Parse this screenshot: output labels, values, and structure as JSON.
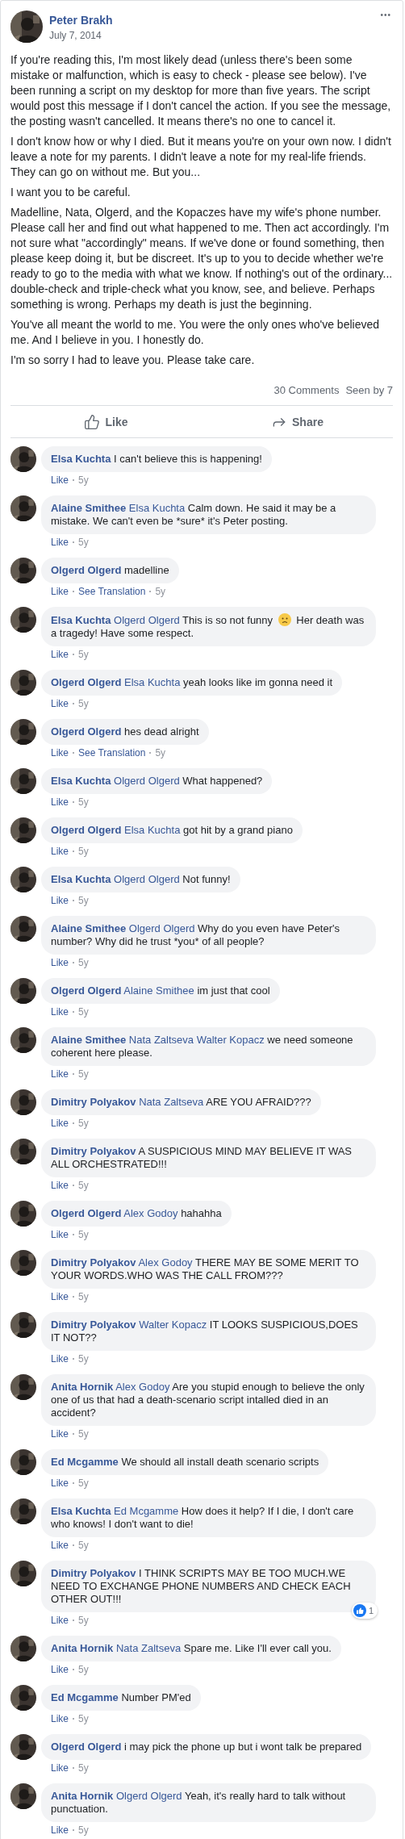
{
  "post": {
    "author": "Peter Brakh",
    "date": "July 7, 2014",
    "menu": "•••",
    "paragraphs": [
      "If you're reading this, I'm most likely dead (unless there's been some mistake or malfunction, which is easy to check - please see below). I've been running a script on my desktop for more than five years. The script would post this message if I don't cancel the action. If you see the message, the posting wasn't cancelled. It means there's no one to cancel it.",
      "I don't know how or why I died. But it means you're on your own now. I didn't leave a note for my parents. I didn't leave a note for my real-life friends. They can go on without me. But you...",
      "I want you to be careful.",
      "Madelline, Nata, Olgerd, and the Kopaczes have my wife's phone number. Please call her and find out what happened to me. Then act accordingly. I'm not sure what \"accordingly\" means. If we've done or found something, then please keep doing it, but be discreet. It's up to you to decide whether we're ready to go to the media with what we know. If nothing's out of the ordinary... double-check and triple-check what you know, see, and believe. Perhaps something is wrong. Perhaps my death is just the beginning.",
      "You've all meant the world to me. You were the only ones who've believed me. And I believe in you. I honestly do.",
      "I'm so sorry I had to leave you. Please take care."
    ],
    "comments_count": "30 Comments",
    "seen_by": "Seen by 7",
    "actions": [
      {
        "kind": "like",
        "label": "Like"
      },
      {
        "kind": "share",
        "label": "Share"
      }
    ]
  },
  "comments": [
    {
      "author": "Elsa Kuchta",
      "parts": [
        {
          "kind": "text",
          "text": "I can't believe this is happening!"
        }
      ],
      "like": "Like",
      "time": "5y"
    },
    {
      "author": "Alaine Smithee",
      "mentions": [
        "Elsa Kuchta"
      ],
      "parts": [
        {
          "kind": "text",
          "text": "Calm down. He said it may be a mistake. We can't even be *sure* it's Peter posting."
        }
      ],
      "like": "Like",
      "time": "5y"
    },
    {
      "author": "Olgerd Olgerd",
      "parts": [
        {
          "kind": "text",
          "text": "madelline"
        }
      ],
      "like": "Like",
      "translation": "See Translation",
      "time": "5y"
    },
    {
      "author": "Elsa Kuchta",
      "mentions": [
        "Olgerd Olgerd"
      ],
      "parts": [
        {
          "kind": "text",
          "text": "This is so not funny"
        },
        {
          "kind": "emoji"
        },
        {
          "kind": "text",
          "text": "Her death was a tragedy! Have some respect."
        }
      ],
      "like": "Like",
      "time": "5y"
    },
    {
      "author": "Olgerd Olgerd",
      "mentions": [
        "Elsa Kuchta"
      ],
      "parts": [
        {
          "kind": "text",
          "text": "yeah looks like im gonna need it"
        }
      ],
      "like": "Like",
      "time": "5y"
    },
    {
      "author": "Olgerd Olgerd",
      "parts": [
        {
          "kind": "text",
          "text": "hes dead alright"
        }
      ],
      "like": "Like",
      "translation": "See Translation",
      "time": "5y"
    },
    {
      "author": "Elsa Kuchta",
      "mentions": [
        "Olgerd Olgerd"
      ],
      "parts": [
        {
          "kind": "text",
          "text": "What happened?"
        }
      ],
      "like": "Like",
      "time": "5y"
    },
    {
      "author": "Olgerd Olgerd",
      "mentions": [
        "Elsa Kuchta"
      ],
      "parts": [
        {
          "kind": "text",
          "text": "got hit by a grand piano"
        }
      ],
      "like": "Like",
      "time": "5y"
    },
    {
      "author": "Elsa Kuchta",
      "mentions": [
        "Olgerd Olgerd"
      ],
      "parts": [
        {
          "kind": "text",
          "text": "Not funny!"
        }
      ],
      "like": "Like",
      "time": "5y"
    },
    {
      "author": "Alaine Smithee",
      "mentions": [
        "Olgerd Olgerd"
      ],
      "parts": [
        {
          "kind": "text",
          "text": "Why do you even have Peter's number? Why did he trust *you* of all people?"
        }
      ],
      "like": "Like",
      "time": "5y"
    },
    {
      "author": "Olgerd Olgerd",
      "mentions": [
        "Alaine Smithee"
      ],
      "parts": [
        {
          "kind": "text",
          "text": "im just that cool"
        }
      ],
      "like": "Like",
      "time": "5y"
    },
    {
      "author": "Alaine Smithee",
      "mentions": [
        "Nata Zaltseva",
        "Walter Kopacz"
      ],
      "parts": [
        {
          "kind": "text",
          "text": "we need someone coherent here please."
        }
      ],
      "like": "Like",
      "time": "5y"
    },
    {
      "author": "Dimitry Polyakov",
      "mentions": [
        "Nata Zaltseva"
      ],
      "parts": [
        {
          "kind": "text",
          "text": "ARE YOU AFRAID???"
        }
      ],
      "like": "Like",
      "time": "5y"
    },
    {
      "author": "Dimitry Polyakov",
      "parts": [
        {
          "kind": "text",
          "text": "A SUSPICIOUS MIND MAY BELIEVE IT WAS ALL ORCHESTRATED!!!"
        }
      ],
      "like": "Like",
      "time": "5y"
    },
    {
      "author": "Olgerd Olgerd",
      "mentions": [
        "Alex Godoy"
      ],
      "parts": [
        {
          "kind": "text",
          "text": "hahahha"
        }
      ],
      "like": "Like",
      "time": "5y"
    },
    {
      "author": "Dimitry Polyakov",
      "mentions": [
        "Alex Godoy"
      ],
      "parts": [
        {
          "kind": "text",
          "text": "THERE MAY BE SOME MERIT TO YOUR WORDS.WHO WAS THE CALL FROM???"
        }
      ],
      "like": "Like",
      "time": "5y"
    },
    {
      "author": "Dimitry Polyakov",
      "mentions": [
        "Walter Kopacz"
      ],
      "parts": [
        {
          "kind": "text",
          "text": "IT LOOKS SUSPICIOUS,DOES IT NOT??"
        }
      ],
      "like": "Like",
      "time": "5y"
    },
    {
      "author": "Anita Hornik",
      "mentions": [
        "Alex Godoy"
      ],
      "parts": [
        {
          "kind": "text",
          "text": "Are you stupid enough to believe the only one of us that had a death-scenario script intalled died in an accident?"
        }
      ],
      "like": "Like",
      "time": "5y"
    },
    {
      "author": "Ed Mcgamme",
      "parts": [
        {
          "kind": "text",
          "text": "We should all install death scenario scripts"
        }
      ],
      "like": "Like",
      "time": "5y"
    },
    {
      "author": "Elsa Kuchta",
      "mentions": [
        "Ed Mcgamme"
      ],
      "parts": [
        {
          "kind": "text",
          "text": "How does it help? If I die, I don't care who knows! I don't want to die!"
        }
      ],
      "like": "Like",
      "time": "5y"
    },
    {
      "author": "Dimitry Polyakov",
      "parts": [
        {
          "kind": "text",
          "text": "I THINK SCRIPTS MAY BE TOO MUCH.WE NEED TO EXCHANGE PHONE NUMBERS AND CHECK EACH OTHER OUT!!!"
        }
      ],
      "like": "Like",
      "time": "5y",
      "reactions": "1"
    },
    {
      "author": "Anita Hornik",
      "mentions": [
        "Nata Zaltseva"
      ],
      "parts": [
        {
          "kind": "text",
          "text": "Spare me. Like I'll ever call you."
        }
      ],
      "like": "Like",
      "time": "5y"
    },
    {
      "author": "Ed Mcgamme",
      "parts": [
        {
          "kind": "text",
          "text": "Number PM'ed"
        }
      ],
      "like": "Like",
      "time": "5y"
    },
    {
      "author": "Olgerd Olgerd",
      "parts": [
        {
          "kind": "text",
          "text": "i may pick the phone up but i wont talk be prepared"
        }
      ],
      "like": "Like",
      "time": "5y"
    },
    {
      "author": "Anita Hornik",
      "mentions": [
        "Olgerd Olgerd"
      ],
      "parts": [
        {
          "kind": "text",
          "text": "Yeah, it's really hard to talk without punctuation."
        }
      ],
      "like": "Like",
      "time": "5y"
    }
  ]
}
